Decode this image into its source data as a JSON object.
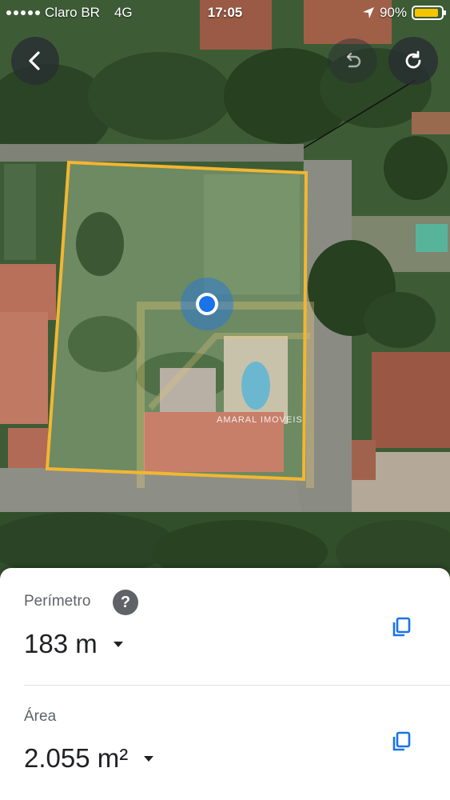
{
  "status_bar": {
    "carrier": "Claro BR",
    "network": "4G",
    "time": "17:05",
    "battery_percent": "90%",
    "battery_level": 0.9,
    "location_icon": "location-arrow-icon",
    "battery_color": "#f5c400"
  },
  "map": {
    "watermark": "AMARAL IMOVEIS",
    "selection_color": "#f2b632",
    "location_dot_color": "#1a73e8"
  },
  "toolbar": {
    "back_icon": "back-arrow-icon",
    "undo_icon": "undo-icon",
    "redo_icon": "redo-icon"
  },
  "measurements": {
    "perimeter": {
      "label": "Perímetro",
      "value": "183 m",
      "help_glyph": "?",
      "help_icon": "help-circle-icon",
      "copy_icon": "copy-icon"
    },
    "area": {
      "label": "Área",
      "value": "2.055 m²",
      "copy_icon": "copy-icon"
    },
    "accent_color": "#1a73e8"
  }
}
